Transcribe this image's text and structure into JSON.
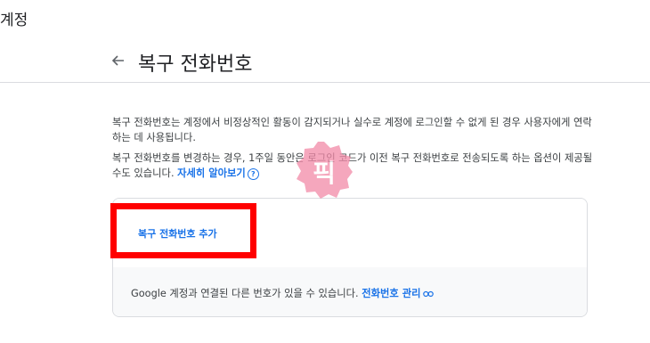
{
  "app": {
    "title": "계정"
  },
  "header": {
    "title": "복구 전화번호",
    "back_icon": "arrow-left-icon"
  },
  "description": {
    "p1": "복구 전화번호는 계정에서 비정상적인 활동이 감지되거나 실수로 계정에 로그인할 수 없게 된 경우 사용자에게 연락하는 데 사용됩니다.",
    "p2": "복구 전화번호를 변경하는 경우, 1주일 동안은 로그인 코드가 이전 복구 전화번호로 전송되도록 하는 옵션이 제공될 수도 있습니다.",
    "learn_more": "자세히 알아보기"
  },
  "card": {
    "add_button": "복구 전화번호 추가",
    "note": "Google 계정과 연결된 다른 번호가 있을 수 있습니다.",
    "manage_link": "전화번호 관리"
  },
  "watermark": {
    "text": "픽"
  },
  "colors": {
    "link": "#1a73e8",
    "highlight": "#ff0000",
    "stamp": "#f28aa8"
  }
}
